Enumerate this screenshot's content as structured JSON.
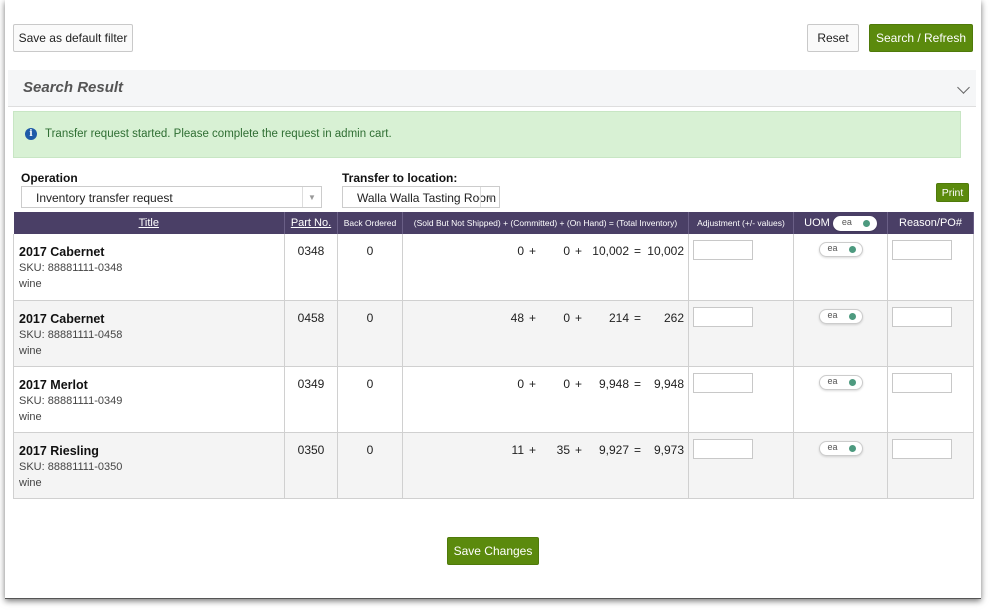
{
  "toolbar": {
    "save_default_label": "Save as default filter",
    "reset_label": "Reset",
    "search_label": "Search / Refresh"
  },
  "result": {
    "title": "Search Result"
  },
  "alert": {
    "icon": "info-icon",
    "icon_glyph": "i",
    "message": "Transfer request started. Please complete the request in admin cart."
  },
  "form": {
    "operation_label": "Operation",
    "operation_value": "Inventory transfer request",
    "transfer_label": "Transfer to location:",
    "transfer_value": "Walla Walla Tasting Room",
    "print_label": "Print"
  },
  "table": {
    "headers": {
      "title": "Title",
      "part_no": "Part No.",
      "back_ordered": "Back Ordered",
      "inventory": "(Sold But Not Shipped) + (Committed) + (On Hand) = (Total Inventory)",
      "adjustment": "Adjustment (+/- values)",
      "uom": "UOM",
      "uom_toggle": "ea",
      "reason": "Reason/PO#"
    },
    "rows": [
      {
        "name": "2017 Cabernet",
        "sku": "SKU: 88881111-0348",
        "category": "wine",
        "part_no": "0348",
        "back_ordered": "0",
        "sold": "0",
        "committed": "0",
        "on_hand": "10,002",
        "total": "10,002",
        "uom": "ea"
      },
      {
        "name": "2017 Cabernet",
        "sku": "SKU: 88881111-0458",
        "category": "wine",
        "part_no": "0458",
        "back_ordered": "0",
        "sold": "48",
        "committed": "0",
        "on_hand": "214",
        "total": "262",
        "uom": "ea"
      },
      {
        "name": "2017 Merlot",
        "sku": "SKU: 88881111-0349",
        "category": "wine",
        "part_no": "0349",
        "back_ordered": "0",
        "sold": "0",
        "committed": "0",
        "on_hand": "9,948",
        "total": "9,948",
        "uom": "ea"
      },
      {
        "name": "2017 Riesling",
        "sku": "SKU: 88881111-0350",
        "category": "wine",
        "part_no": "0350",
        "back_ordered": "0",
        "sold": "11",
        "committed": "35",
        "on_hand": "9,927",
        "total": "9,973",
        "uom": "ea"
      }
    ],
    "plus": "+",
    "equals": "="
  },
  "footer": {
    "save_changes_label": "Save Changes"
  },
  "colors": {
    "accent": "#5b8a0d",
    "header_bg": "#4a3f66",
    "alert_bg": "#d8f1d4"
  }
}
